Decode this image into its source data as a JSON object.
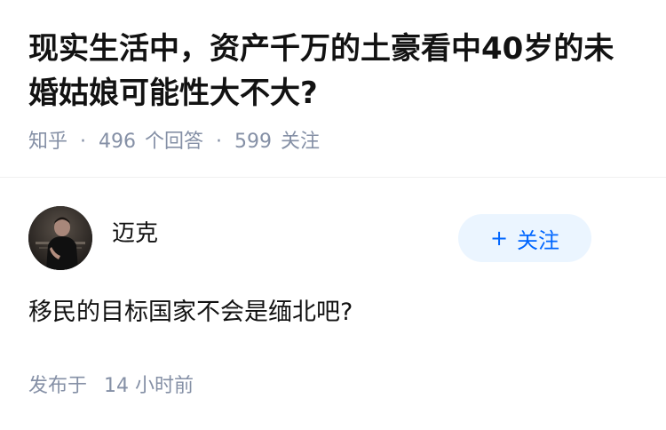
{
  "question": {
    "title": "现实生活中，资产千万的土豪看中40岁的未婚姑娘可能性大不大?",
    "meta": {
      "source": "知乎",
      "answers_count": "496",
      "answers_label": "个回答",
      "followers_count": "599",
      "followers_label": "关注"
    }
  },
  "answer": {
    "author": {
      "name": "迈克",
      "avatar": "avatar-icon"
    },
    "follow_button": {
      "icon": "+",
      "label": "关注"
    },
    "content": "移民的目标国家不会是缅北吧?",
    "published_prefix": "发布于",
    "published_count": "14",
    "published_suffix": "小时前"
  },
  "colors": {
    "accent": "#0066ff",
    "button_bg": "#ebf5ff",
    "meta_gray": "#8590a6",
    "text": "#121212"
  }
}
